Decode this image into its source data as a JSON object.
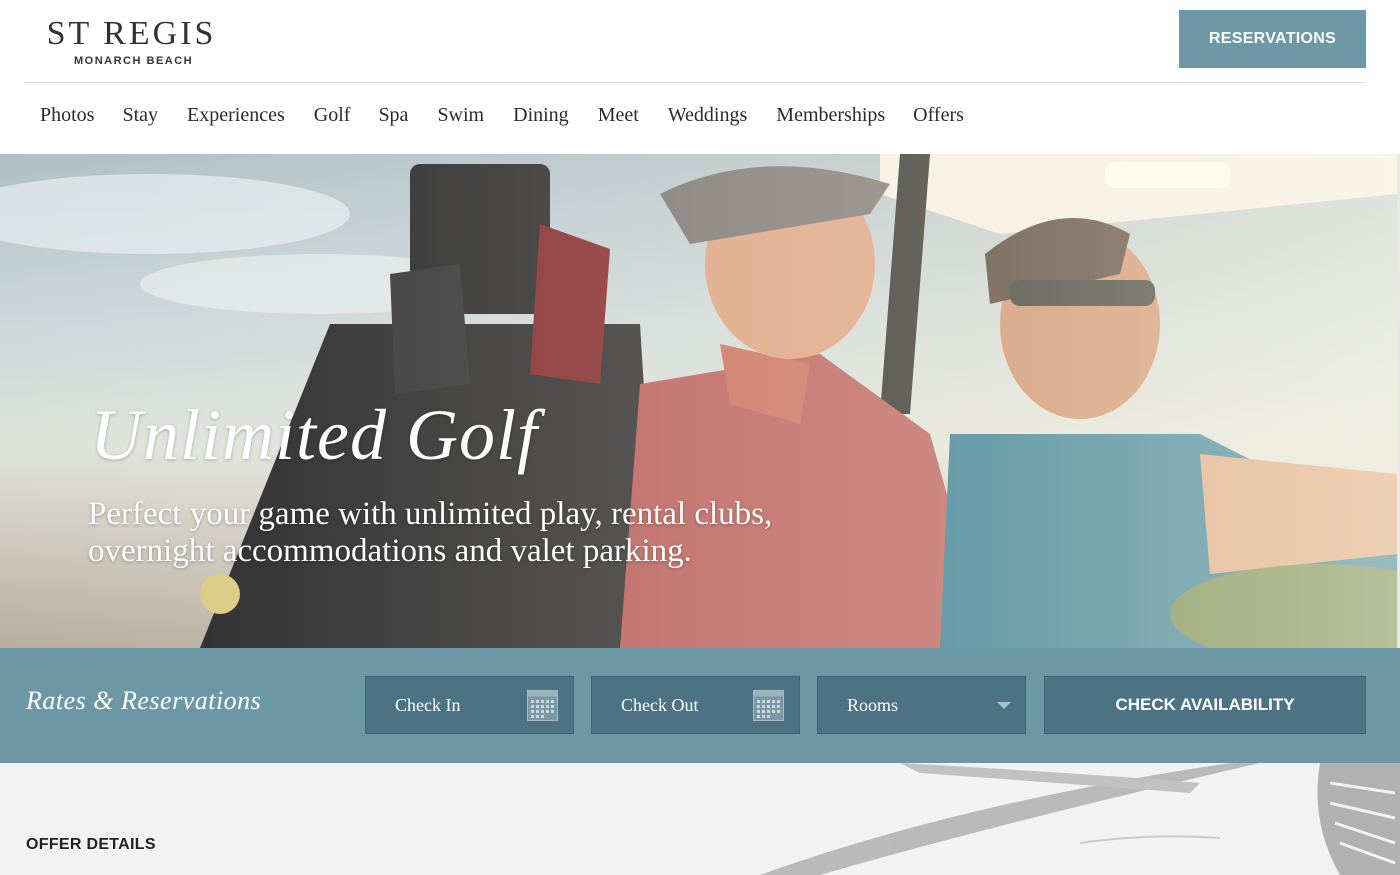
{
  "header": {
    "logo_main": "ST REGIS",
    "logo_sub": "MONARCH BEACH",
    "reservations_label": "RESERVATIONS"
  },
  "nav": {
    "items": [
      "Photos",
      "Stay",
      "Experiences",
      "Golf",
      "Spa",
      "Swim",
      "Dining",
      "Meet",
      "Weddings",
      "Memberships",
      "Offers"
    ]
  },
  "hero": {
    "title": "Unlimited Golf",
    "subtitle_line1": "Perfect your game with unlimited play, rental clubs,",
    "subtitle_line2": "overnight accommodations and valet parking."
  },
  "booking": {
    "title": "Rates & Reservations",
    "check_in_label": "Check In",
    "check_out_label": "Check Out",
    "rooms_label": "Rooms",
    "check_availability_label": "CHECK AVAILABILITY"
  },
  "offer": {
    "title": "OFFER DETAILS"
  },
  "icons": {
    "check_in": "calendar-icon",
    "check_out": "calendar-icon",
    "rooms": "chevron-down-icon"
  },
  "colors": {
    "accent": "#6d99a7",
    "field_bg": "#4d7283",
    "booking_bar": "#6c98a6",
    "offer_bg": "#f2f2f2"
  }
}
